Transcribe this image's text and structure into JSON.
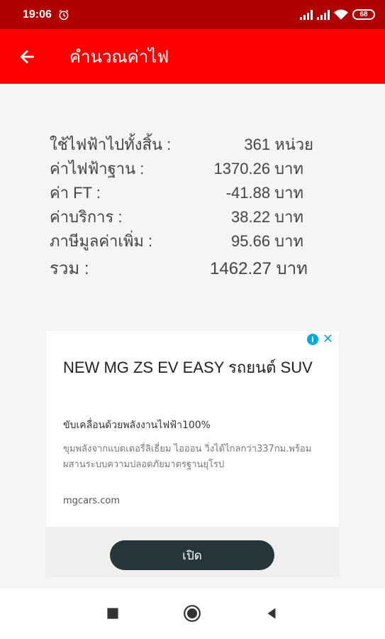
{
  "status_bar": {
    "time": "19:06",
    "battery": "68"
  },
  "app_bar": {
    "title": "คำนวณค่าไฟ"
  },
  "summary": {
    "rows": [
      {
        "label": "ใช้ไฟฟ้าไปทั้งสิ้น :",
        "value": "361 หน่วย"
      },
      {
        "label": "ค่าไฟฟ้าฐาน :",
        "value": "1370.26 บาท"
      },
      {
        "label": "ค่า FT :",
        "value": "-41.88 บาท"
      },
      {
        "label": "ค่าบริการ :",
        "value": "38.22 บาท"
      },
      {
        "label": "ภาษีมูลค่าเพิ่ม :",
        "value": "95.66 บาท"
      }
    ],
    "total": {
      "label": "รวม :",
      "value": "1462.27 บาท"
    }
  },
  "ad": {
    "headline": "NEW MG ZS EV EASY รถยนต์ SUV",
    "subheadline": "ขับเคลื่อนด้วยพลังงานไฟฟ้า100%",
    "description": "ขุมพลังจากแบตเตอรี่ลิเธี่ยม ไอออน วิ่งได้ไกลกว่า337กม.พร้อมผสานระบบความปลอดภัยมาตรฐานยุโรป",
    "url": "mgcars.com",
    "cta": "เปิด",
    "accent_color": "#00aad8"
  },
  "colors": {
    "status_bar": "#b00000",
    "app_bar": "#ff0000",
    "background": "#f5f5f5",
    "cta": "#26363a"
  }
}
